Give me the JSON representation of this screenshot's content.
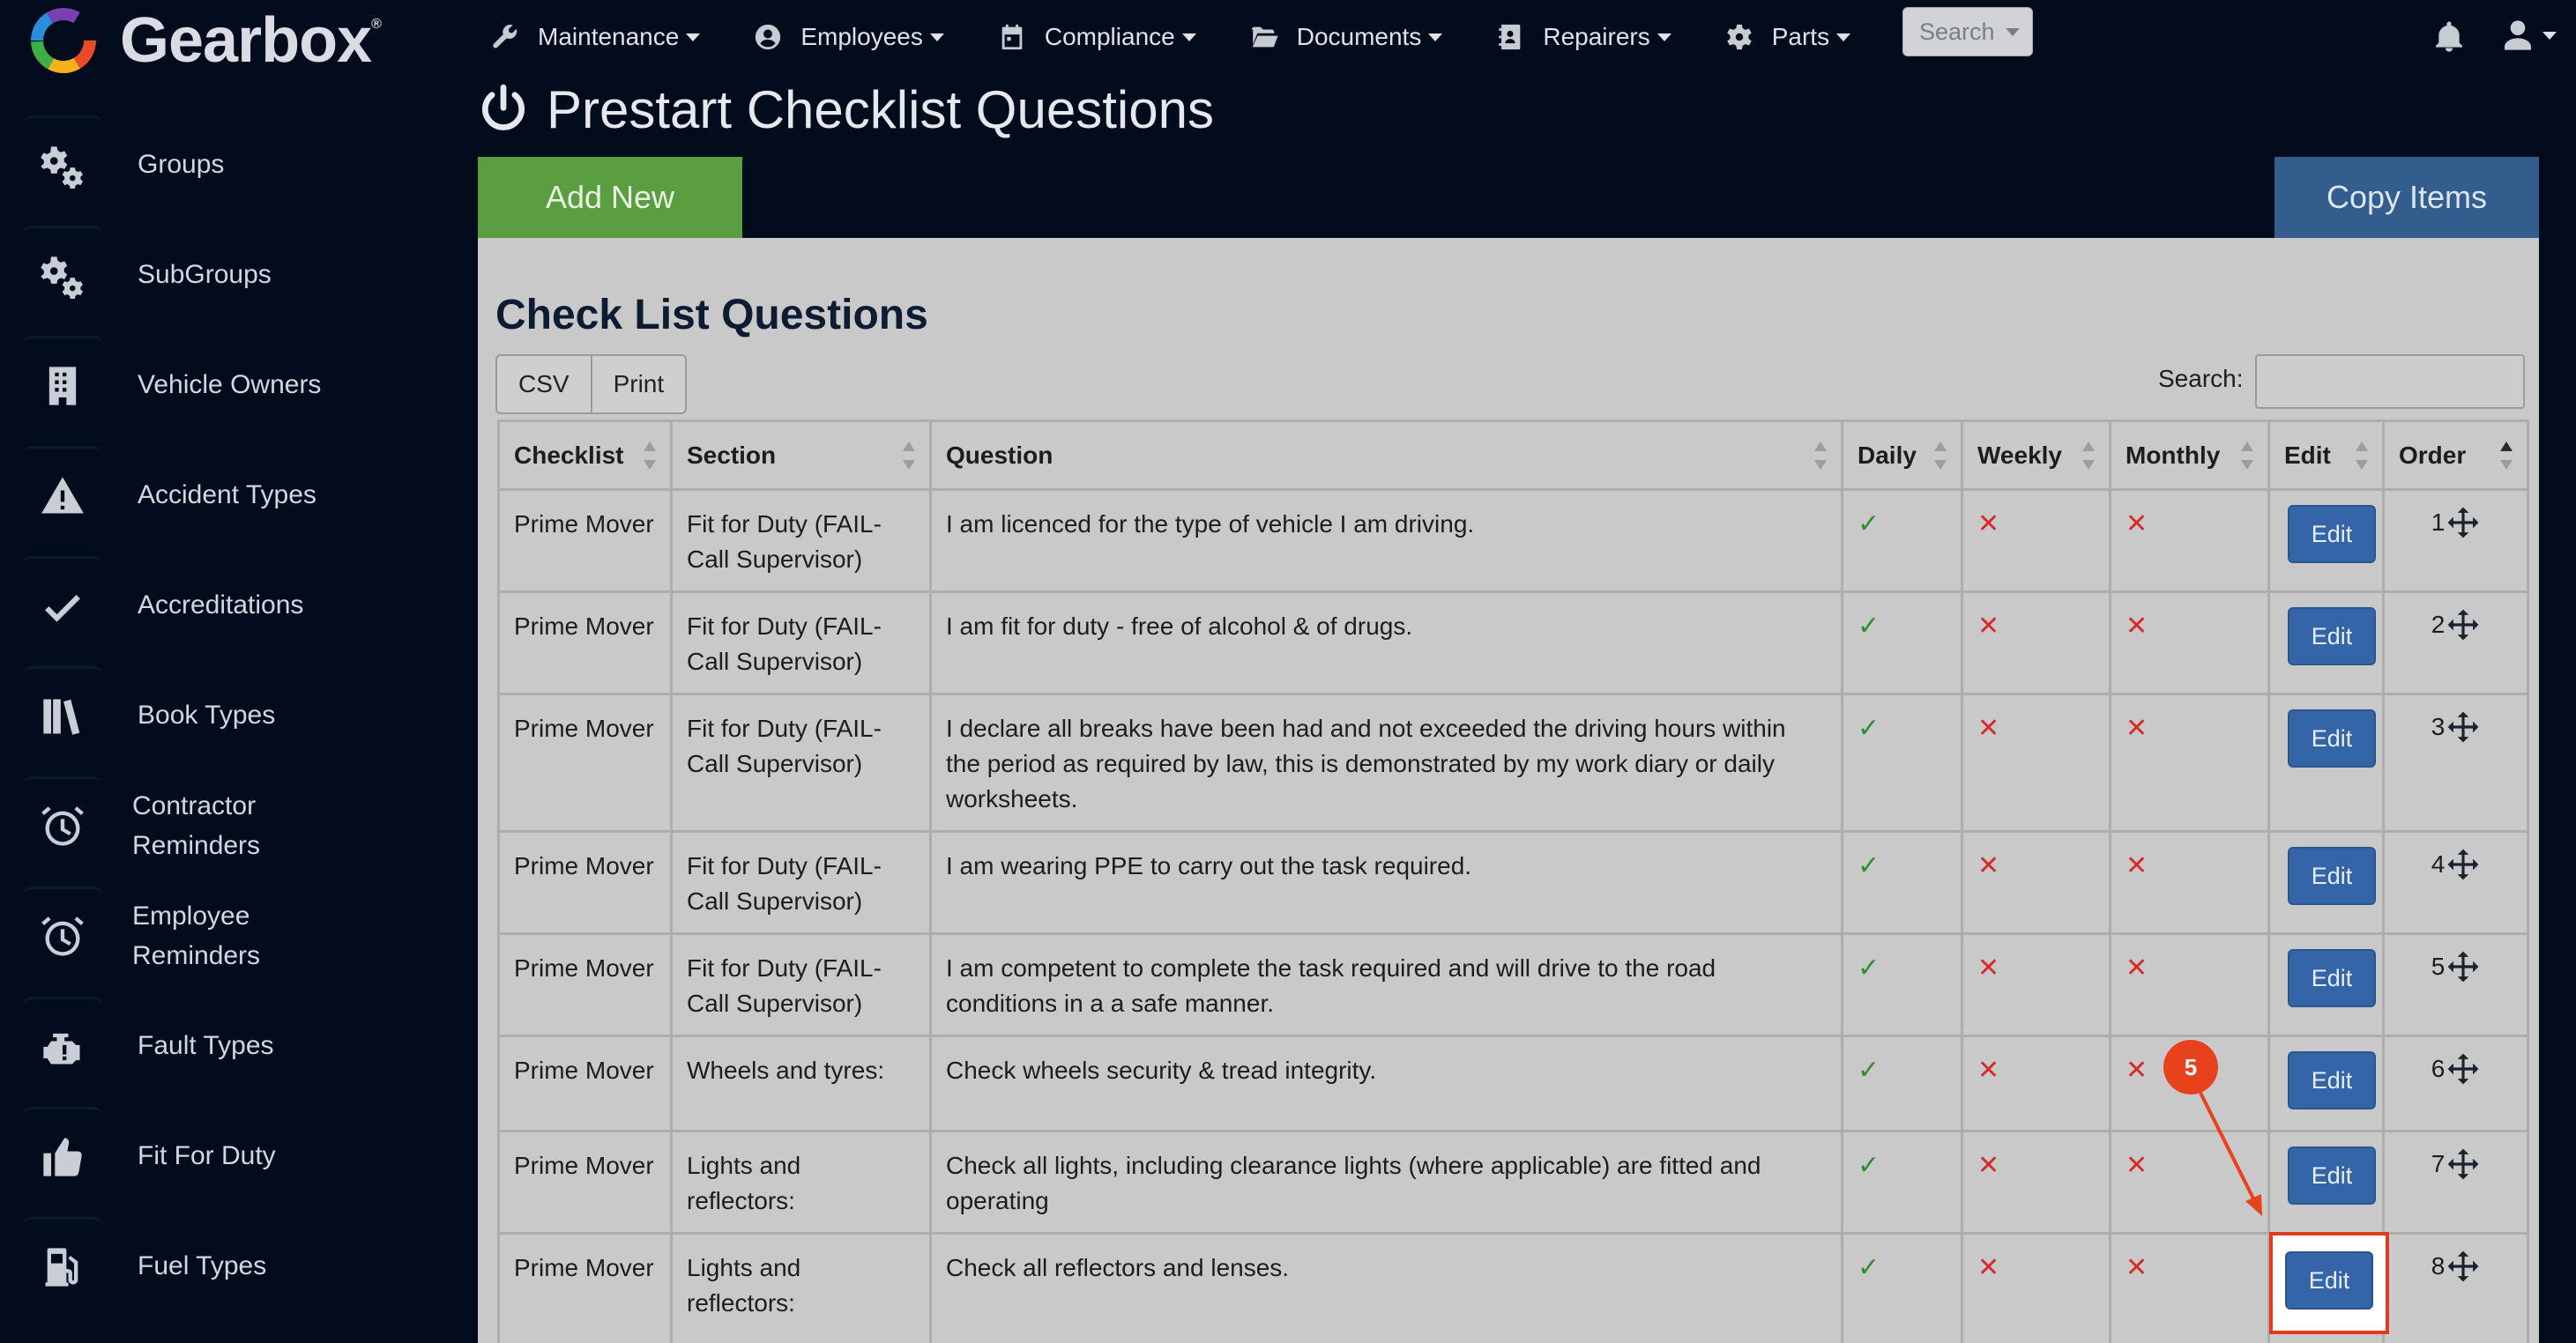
{
  "brand": {
    "name": "Gearbox",
    "mark": "®"
  },
  "nav": [
    {
      "label": "Maintenance",
      "icon": "wrench-icon"
    },
    {
      "label": "Employees",
      "icon": "user-circle-icon"
    },
    {
      "label": "Compliance",
      "icon": "calendar-icon"
    },
    {
      "label": "Documents",
      "icon": "folder-open-icon"
    },
    {
      "label": "Repairers",
      "icon": "address-book-icon"
    },
    {
      "label": "Parts",
      "icon": "gear-icon"
    }
  ],
  "search_button": {
    "label": "Search"
  },
  "sidebar": [
    {
      "label": "Groups",
      "icon": "gears-icon"
    },
    {
      "label": "SubGroups",
      "icon": "gears-icon"
    },
    {
      "label": "Vehicle Owners",
      "icon": "building-icon"
    },
    {
      "label": "Accident Types",
      "icon": "warning-triangle-icon"
    },
    {
      "label": "Accreditations",
      "icon": "checkmark-icon"
    },
    {
      "label": "Book Types",
      "icon": "books-icon"
    },
    {
      "label": "Contractor Reminders",
      "line1": "Contractor",
      "line2": "Reminders",
      "icon": "alarm-clock-icon"
    },
    {
      "label": "Employee Reminders",
      "line1": "Employee",
      "line2": "Reminders",
      "icon": "alarm-clock-icon"
    },
    {
      "label": "Fault Types",
      "icon": "engine-warning-icon"
    },
    {
      "label": "Fit For Duty",
      "icon": "thumbs-up-icon"
    },
    {
      "label": "Fuel Types",
      "icon": "fuel-pump-icon"
    }
  ],
  "page": {
    "title": "Prestart Checklist Questions",
    "title_icon": "power-icon",
    "add_new_label": "Add New",
    "copy_items_label": "Copy Items"
  },
  "panel": {
    "title": "Check List Questions",
    "csv_label": "CSV",
    "print_label": "Print",
    "search_label": "Search:",
    "search_value": ""
  },
  "table": {
    "columns": [
      "Checklist",
      "Section",
      "Question",
      "Daily",
      "Weekly",
      "Monthly",
      "Edit",
      "Order"
    ],
    "edit_label": "Edit",
    "rows": [
      {
        "checklist": "Prime Mover",
        "section": [
          "Fit for Duty (FAIL-",
          "Call Supervisor)"
        ],
        "question": [
          "I am licenced for the type of vehicle I am driving."
        ],
        "daily": "✓",
        "weekly": "✕",
        "monthly": "✕",
        "order": "1"
      },
      {
        "checklist": "Prime Mover",
        "section": [
          "Fit for Duty (FAIL-",
          "Call Supervisor)"
        ],
        "question": [
          "I am fit for duty - free of alcohol & of drugs."
        ],
        "daily": "✓",
        "weekly": "✕",
        "monthly": "✕",
        "order": "2"
      },
      {
        "checklist": "Prime Mover",
        "section": [
          "Fit for Duty (FAIL-",
          "Call Supervisor)"
        ],
        "question": [
          "I declare all breaks have been had and not exceeded the driving hours within",
          "the period as required by law, this is demonstrated by my work diary or daily",
          "worksheets."
        ],
        "daily": "✓",
        "weekly": "✕",
        "monthly": "✕",
        "order": "3"
      },
      {
        "checklist": "Prime Mover",
        "section": [
          "Fit for Duty (FAIL-",
          "Call Supervisor)"
        ],
        "question": [
          "I am wearing PPE to carry out the task required."
        ],
        "daily": "✓",
        "weekly": "✕",
        "monthly": "✕",
        "order": "4"
      },
      {
        "checklist": "Prime Mover",
        "section": [
          "Fit for Duty (FAIL-",
          "Call Supervisor)"
        ],
        "question": [
          "I am competent to complete the task required and will drive to the road",
          "conditions in a a safe manner."
        ],
        "daily": "✓",
        "weekly": "✕",
        "monthly": "✕",
        "order": "5"
      },
      {
        "checklist": "Prime Mover",
        "section": [
          "Wheels and tyres:"
        ],
        "question": [
          "Check wheels security & tread integrity."
        ],
        "daily": "✓",
        "weekly": "✕",
        "monthly": "✕",
        "order": "6"
      },
      {
        "checklist": "Prime Mover",
        "section": [
          "Lights and",
          "reflectors:"
        ],
        "question": [
          "Check all lights, including clearance lights (where applicable) are fitted and",
          "operating"
        ],
        "daily": "✓",
        "weekly": "✕",
        "monthly": "✕",
        "order": "7"
      },
      {
        "checklist": "Prime Mover",
        "section": [
          "Lights and",
          "reflectors:"
        ],
        "question": [
          "Check all reflectors and lenses."
        ],
        "daily": "✓",
        "weekly": "✕",
        "monthly": "✕",
        "order": "8"
      }
    ]
  },
  "annotation": {
    "step": "5"
  },
  "colors": {
    "background": "#020c1c",
    "add_new": "#5b9d41",
    "copy_items": "#325d8d",
    "edit": "#3565a9",
    "annotation": "#e8421d"
  }
}
